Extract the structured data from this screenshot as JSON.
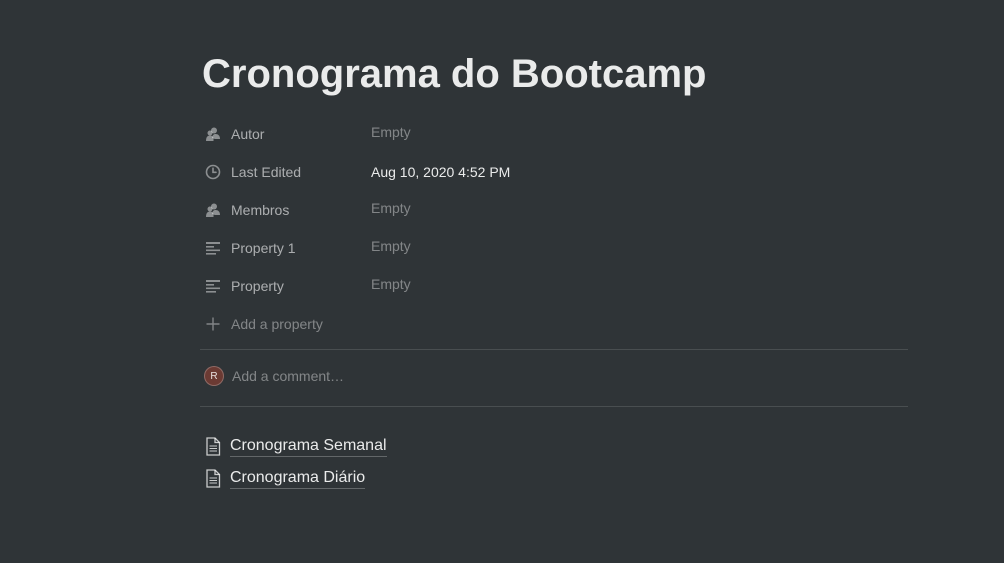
{
  "page": {
    "title": "Cronograma do Bootcamp"
  },
  "properties": [
    {
      "icon": "person-icon",
      "name": "Autor",
      "value": "Empty",
      "empty": true
    },
    {
      "icon": "clock-icon",
      "name": "Last Edited",
      "value": "Aug 10, 2020 4:52 PM",
      "empty": false
    },
    {
      "icon": "person-icon",
      "name": "Membros",
      "value": "Empty",
      "empty": true
    },
    {
      "icon": "text-lines-icon",
      "name": "Property 1",
      "value": "Empty",
      "empty": true
    },
    {
      "icon": "text-lines-icon",
      "name": "Property",
      "value": "Empty",
      "empty": true
    }
  ],
  "add_property": {
    "icon": "plus-icon",
    "label": "Add a property"
  },
  "comment": {
    "avatar_initial": "R",
    "placeholder": "Add a comment…"
  },
  "subpages": [
    {
      "icon": "document-icon",
      "label": "Cronograma Semanal"
    },
    {
      "icon": "document-icon",
      "label": "Cronograma Diário"
    }
  ],
  "colors": {
    "background": "#2f3437",
    "avatar": "#6b3a33"
  }
}
